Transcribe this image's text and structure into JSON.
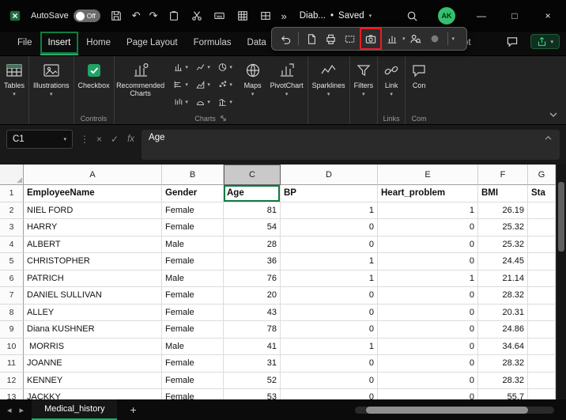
{
  "window": {
    "autosave_label": "AutoSave",
    "autosave_state": "Off",
    "doc_title": "Diab...",
    "doc_status": "Saved",
    "avatar_initials": "AK"
  },
  "icons": {
    "overflow": "»",
    "dropdown": "▾",
    "separator_dot": "•",
    "undo": "↶",
    "redo": "↷",
    "minimize": "—",
    "maximize": "□",
    "close": "×",
    "more_dots": "⋮",
    "cancel": "×",
    "enter": "✓",
    "fx": "fx",
    "prev_sheet": "◂",
    "next_sheet": "▸",
    "select_all": "◢"
  },
  "quick_toolbar": {
    "icon_names": [
      "undo",
      "blank-page",
      "print",
      "screen-clip",
      "camera",
      "chart",
      "person-search",
      "record",
      "more"
    ],
    "highlighted_icon": "camera",
    "highlight_color": "#ee1c25"
  },
  "ribbon": {
    "tabs": [
      "File",
      "Insert",
      "Home",
      "Page Layout",
      "Formulas",
      "Data"
    ],
    "active_tab": "Insert",
    "partial_tab": "ot",
    "buttons": {
      "tables": "Tables",
      "illustrations": "Illustrations",
      "checkbox": "Checkbox",
      "recommended_charts": "Recommended Charts",
      "maps": "Maps",
      "pivotchart": "PivotChart",
      "sparklines": "Sparklines",
      "filters": "Filters",
      "link": "Link",
      "comment_partial": "Con"
    },
    "group_labels": {
      "controls": "Controls",
      "charts": "Charts",
      "links": "Links",
      "comments": "Com"
    },
    "accent_green": "#26a968"
  },
  "formula_bar": {
    "name_box": "C1",
    "formula": "Age"
  },
  "sheet": {
    "column_letters": [
      "A",
      "B",
      "C",
      "D",
      "E",
      "F",
      "G"
    ],
    "selected_column": "C",
    "active_cell": "C1",
    "header_row": [
      "EmployeeName",
      "Gender",
      "Age",
      "BP",
      "Heart_problem",
      "BMI",
      "Sta"
    ],
    "rows": [
      [
        "NIEL FORD",
        "Female",
        "81",
        "1",
        "1",
        "26.19",
        ""
      ],
      [
        "HARRY",
        "Female",
        "54",
        "0",
        "0",
        "25.32",
        ""
      ],
      [
        "ALBERT",
        "Male",
        "28",
        "0",
        "0",
        "25.32",
        ""
      ],
      [
        "CHRISTOPHER",
        "Female",
        "36",
        "1",
        "0",
        "24.45",
        ""
      ],
      [
        "PATRICH",
        "Male",
        "76",
        "1",
        "1",
        "21.14",
        ""
      ],
      [
        "DANIEL SULLIVAN",
        "Female",
        "20",
        "0",
        "0",
        "28.32",
        ""
      ],
      [
        "ALLEY",
        "Female",
        "43",
        "0",
        "0",
        "20.31",
        ""
      ],
      [
        "Diana KUSHNER",
        "Female",
        "78",
        "0",
        "0",
        "24.86",
        ""
      ],
      [
        " MORRIS",
        "Male",
        "41",
        "1",
        "0",
        "34.64",
        ""
      ],
      [
        "JOANNE",
        "Female",
        "31",
        "0",
        "0",
        "28.32",
        ""
      ],
      [
        "KENNEY",
        "Female",
        "52",
        "0",
        "0",
        "28.32",
        ""
      ],
      [
        "JACKKY",
        "Female",
        "53",
        "0",
        "0",
        "55.7",
        ""
      ]
    ],
    "sheet_name": "Medical_history",
    "add_sheet_label": "+"
  }
}
